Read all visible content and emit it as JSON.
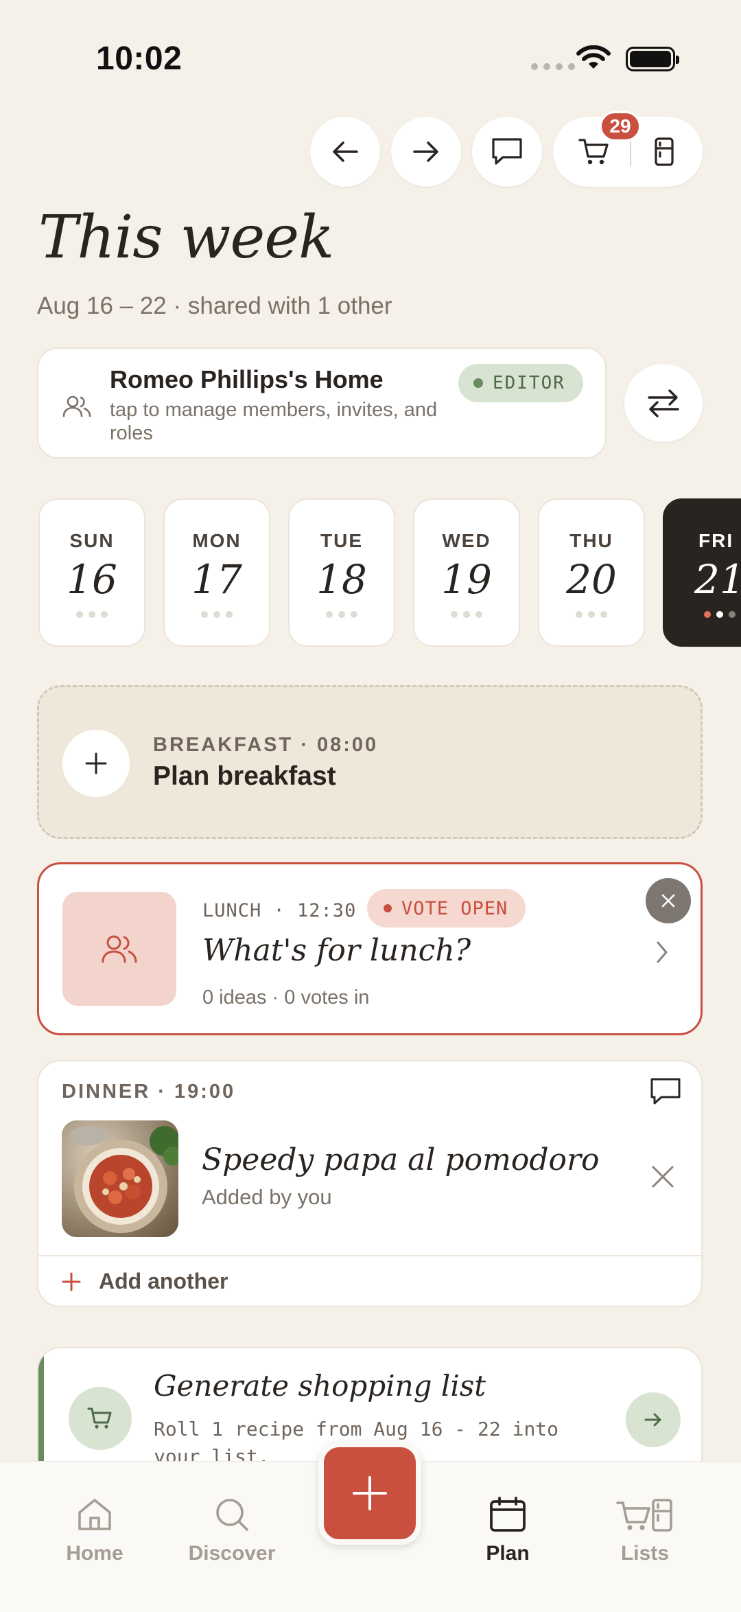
{
  "status_bar": {
    "time": "10:02"
  },
  "top_nav": {
    "cart_count": "29"
  },
  "header": {
    "title": "This week",
    "subtitle": "Aug 16 – 22 · shared with 1 other"
  },
  "household": {
    "name": "Romeo Phillips's Home",
    "description": "tap to manage members, invites, and roles",
    "role_badge": "EDITOR"
  },
  "days": [
    {
      "name": "SUN",
      "num": "16"
    },
    {
      "name": "MON",
      "num": "17"
    },
    {
      "name": "TUE",
      "num": "18"
    },
    {
      "name": "WED",
      "num": "19"
    },
    {
      "name": "THU",
      "num": "20"
    },
    {
      "name": "FRI",
      "num": "21"
    }
  ],
  "breakfast": {
    "label": "BREAKFAST · 08:00",
    "title": "Plan breakfast"
  },
  "lunch": {
    "label": "LUNCH · 12:30",
    "vote_badge": "VOTE OPEN",
    "title": "What's for lunch?",
    "meta": "0 ideas · 0 votes in"
  },
  "dinner": {
    "label": "DINNER · 19:00",
    "recipe_title": "Speedy papa al pomodoro",
    "recipe_meta": "Added by you",
    "add_label": "Add another"
  },
  "shopping": {
    "title": "Generate shopping list",
    "description": "Roll 1 recipe from Aug 16 - 22 into your list."
  },
  "tabs": [
    {
      "label": "Home"
    },
    {
      "label": "Discover"
    },
    {
      "label": "Plan"
    },
    {
      "label": "Lists"
    }
  ],
  "colors": {
    "background": "#f5f0e8",
    "accent": "#c94f3f",
    "sage": "#6a8a60",
    "ink": "#2a2420"
  }
}
